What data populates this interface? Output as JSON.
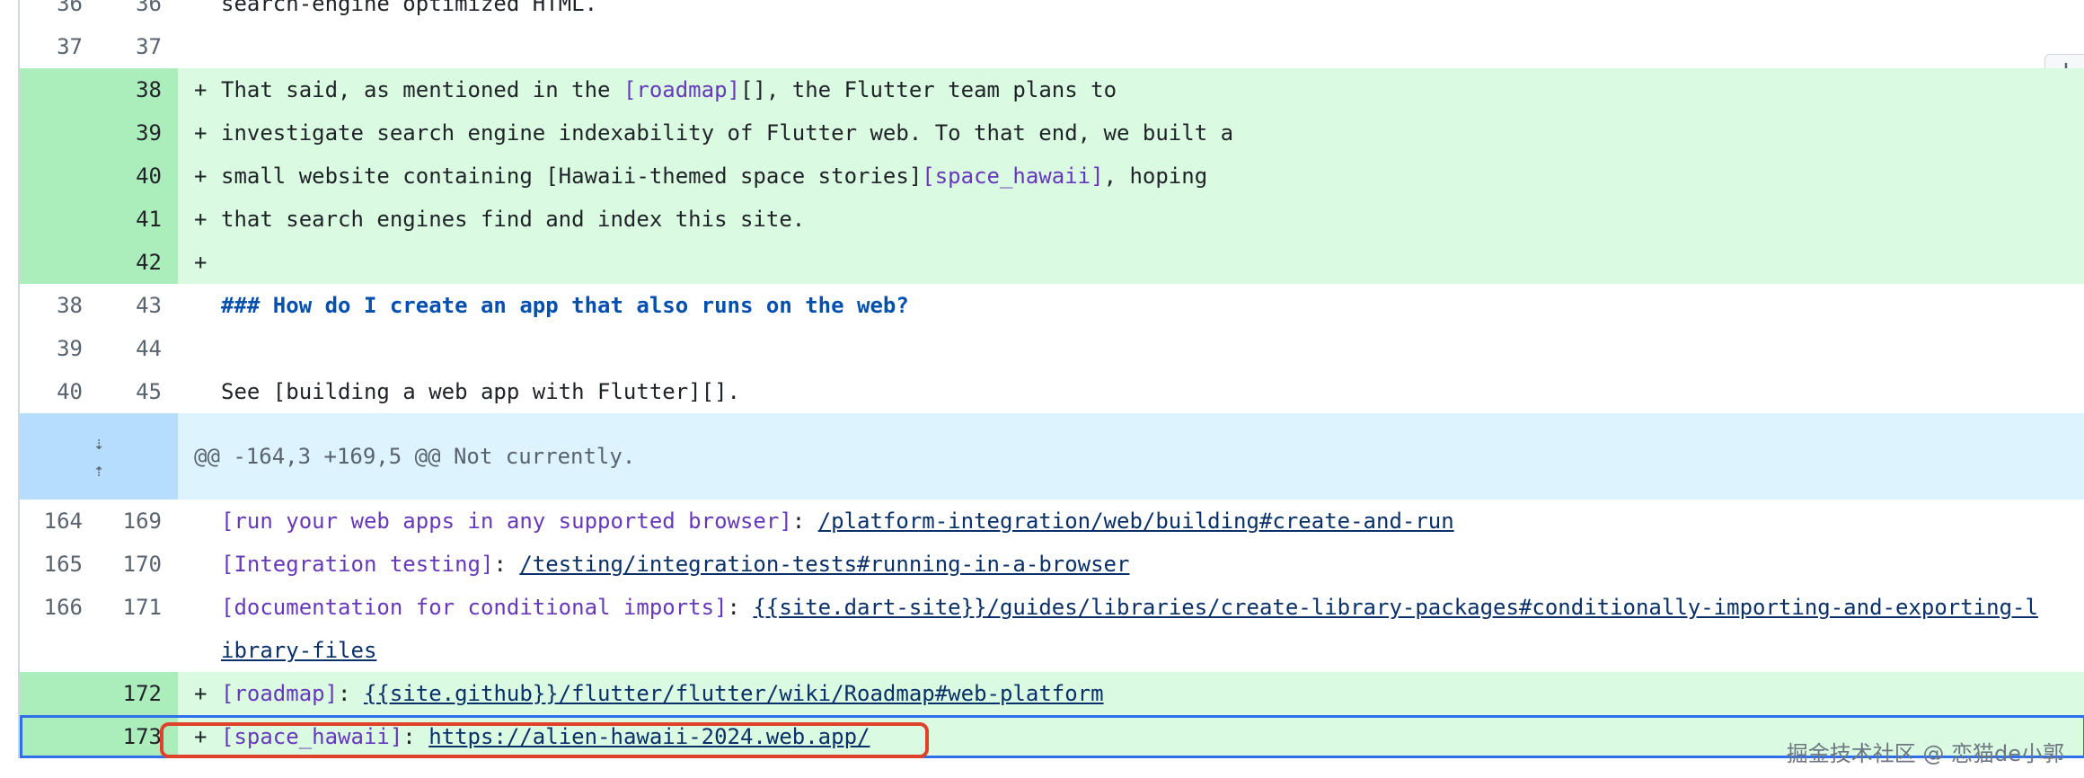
{
  "plus_button": "+",
  "rows": [
    {
      "type": "ctx",
      "old": "36",
      "new": "36",
      "marker": "",
      "text": "search-engine optimized HTML."
    },
    {
      "type": "ctx",
      "old": "37",
      "new": "37",
      "marker": "",
      "text": ""
    },
    {
      "type": "add",
      "old": "",
      "new": "38",
      "marker": "+",
      "text_pre": "That said, as mentioned in the ",
      "link": "[roadmap]",
      "text_post": "[], the Flutter team plans to"
    },
    {
      "type": "add",
      "old": "",
      "new": "39",
      "marker": "+",
      "text": "investigate search engine indexability of Flutter web. To that end, we built a"
    },
    {
      "type": "add",
      "old": "",
      "new": "40",
      "marker": "+",
      "text_pre": "small website containing ",
      "bracket_text": "[Hawaii-themed space stories]",
      "link": "[space_hawaii]",
      "text_post": ", hoping"
    },
    {
      "type": "add",
      "old": "",
      "new": "41",
      "marker": "+",
      "text": "that search engines find and index this site."
    },
    {
      "type": "add",
      "old": "",
      "new": "42",
      "marker": "+",
      "text": ""
    },
    {
      "type": "ctx",
      "old": "38",
      "new": "43",
      "marker": "",
      "heading": "### How do I create an app that also runs on the web?"
    },
    {
      "type": "ctx",
      "old": "39",
      "new": "44",
      "marker": "",
      "text": ""
    },
    {
      "type": "ctx",
      "old": "40",
      "new": "45",
      "marker": "",
      "text": "See [building a web app with Flutter][]."
    }
  ],
  "hunk": {
    "expand_down_icon": "⇣",
    "expand_up_icon": "⇡",
    "text": "@@ -164,3 +169,5 @@ Not currently."
  },
  "rows2": [
    {
      "old": "164",
      "new": "169",
      "label": "[run your web apps in any supported browser]",
      "sep": ": ",
      "url": "/platform-integration/web/building#create-and-run"
    },
    {
      "old": "165",
      "new": "170",
      "label": "[Integration testing]",
      "sep": ": ",
      "url": "/testing/integration-tests#running-in-a-browser"
    },
    {
      "old": "166",
      "new": "171",
      "label": "[documentation for conditional imports]",
      "sep": ": ",
      "url": "{{site.dart-site}}/guides/libraries/create-library-packages#conditionally-importing-and-exporting-library-files"
    },
    {
      "old": "",
      "new": "172",
      "marker": "+",
      "label": "[roadmap]",
      "sep": ": ",
      "url": "{{site.github}}/flutter/flutter/wiki/Roadmap#web-platform"
    },
    {
      "old": "",
      "new": "173",
      "marker": "+",
      "label": "[space_hawaii]",
      "sep": ": ",
      "url": "https://alien-hawaii-2024.web.app/"
    }
  ],
  "watermark": "掘金技术社区 @ 恋猫de小郭",
  "colors": {
    "add_bg": "#dafbe1",
    "add_num_bg": "#aceebb",
    "hunk_bg": "#ddf4ff",
    "highlight": "#e0412a"
  }
}
